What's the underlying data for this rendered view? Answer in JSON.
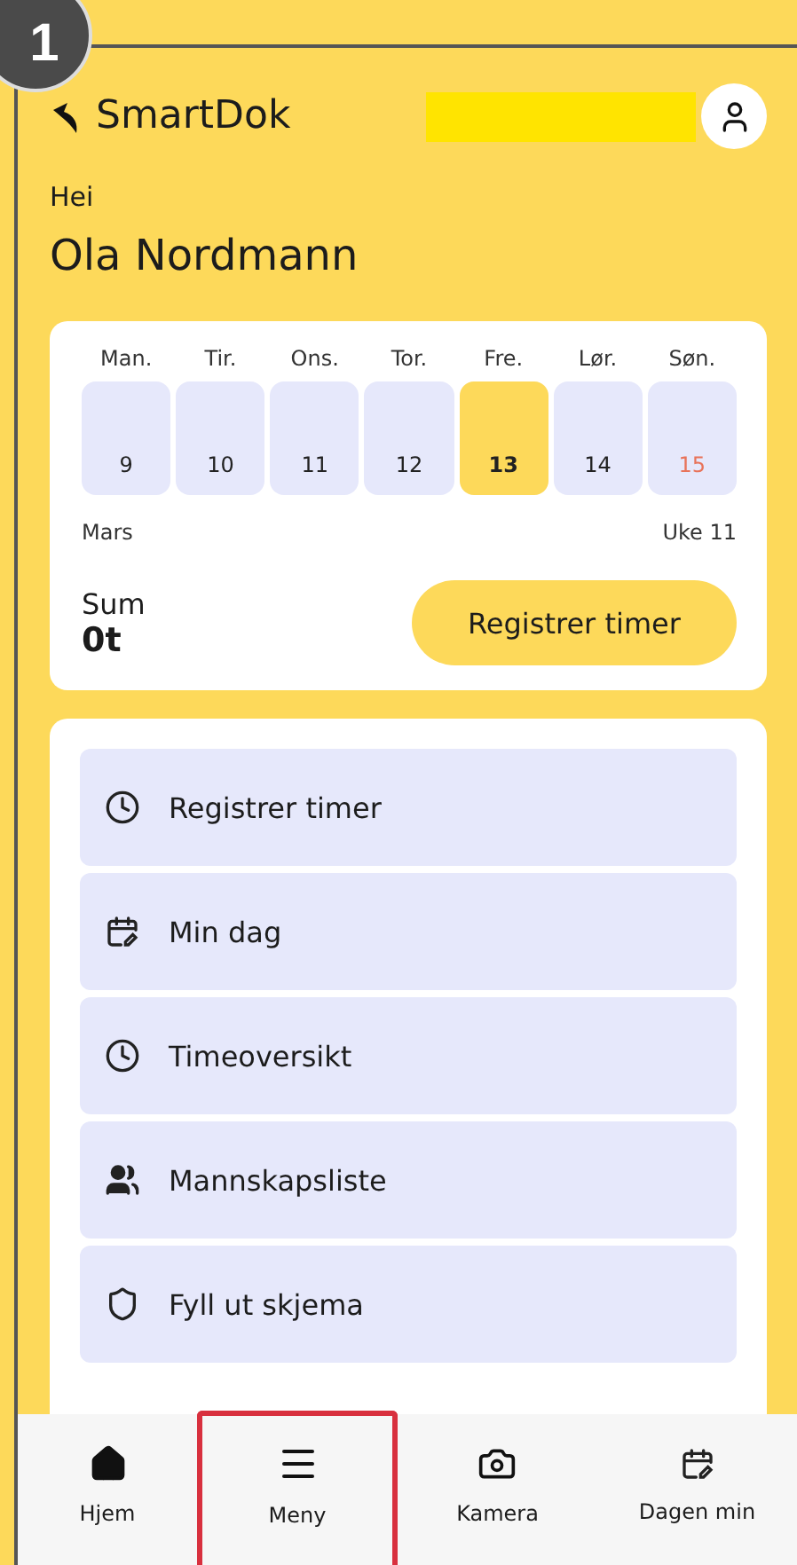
{
  "annotation": {
    "badge": "1"
  },
  "header": {
    "logo": "SmartDok",
    "redacted": true
  },
  "greeting": "Hei",
  "user_name": "Ola Nordmann",
  "week": {
    "days": [
      {
        "label": "Man.",
        "date": "9",
        "selected": false,
        "holiday": false
      },
      {
        "label": "Tir.",
        "date": "10",
        "selected": false,
        "holiday": false
      },
      {
        "label": "Ons.",
        "date": "11",
        "selected": false,
        "holiday": false
      },
      {
        "label": "Tor.",
        "date": "12",
        "selected": false,
        "holiday": false
      },
      {
        "label": "Fre.",
        "date": "13",
        "selected": true,
        "holiday": false
      },
      {
        "label": "Lør.",
        "date": "14",
        "selected": false,
        "holiday": false
      },
      {
        "label": "Søn.",
        "date": "15",
        "selected": false,
        "holiday": true
      }
    ],
    "month": "Mars",
    "week_label": "Uke 11",
    "sum_label": "Sum",
    "sum_value": "0t",
    "register_button": "Registrer timer"
  },
  "menu": [
    "Registrer timer",
    "Min dag",
    "Timeoversikt",
    "Mannskapsliste",
    "Fyll ut skjema"
  ],
  "bottom_nav": [
    {
      "label": "Hjem",
      "highlighted": false
    },
    {
      "label": "Meny",
      "highlighted": true
    },
    {
      "label": "Kamera",
      "highlighted": false
    },
    {
      "label": "Dagen min",
      "highlighted": false
    }
  ]
}
